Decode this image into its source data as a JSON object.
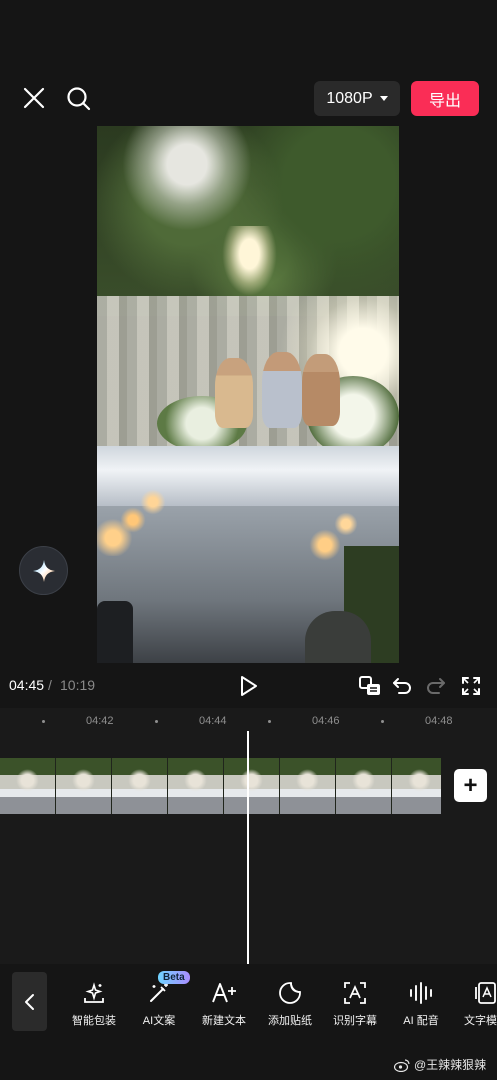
{
  "header": {
    "resolution_label": "1080P",
    "export_label": "导出",
    "close_icon": "close-icon",
    "search_icon": "search-icon"
  },
  "playback": {
    "current_time": "04:45",
    "separator": "/",
    "total_time": "10:19"
  },
  "timeline": {
    "ruler_labels": [
      "04:42",
      "04:44",
      "04:46",
      "04:48"
    ],
    "add_clip_label": "+"
  },
  "toolbar": {
    "items": [
      {
        "label": "智能包装",
        "icon": "smart-package-icon"
      },
      {
        "label": "AI文案",
        "icon": "ai-copywriting-icon",
        "badge": "Beta"
      },
      {
        "label": "新建文本",
        "icon": "new-text-icon"
      },
      {
        "label": "添加贴纸",
        "icon": "sticker-icon"
      },
      {
        "label": "识别字幕",
        "icon": "caption-recognition-icon"
      },
      {
        "label": "AI 配音",
        "icon": "ai-voice-icon"
      },
      {
        "label": "文字模",
        "icon": "text-template-icon"
      }
    ]
  },
  "watermark": {
    "text": "@王辣辣狠辣"
  },
  "colors": {
    "background": "#151515",
    "export_button": "#fa2d56",
    "resolution_button": "#2a2a2a"
  }
}
